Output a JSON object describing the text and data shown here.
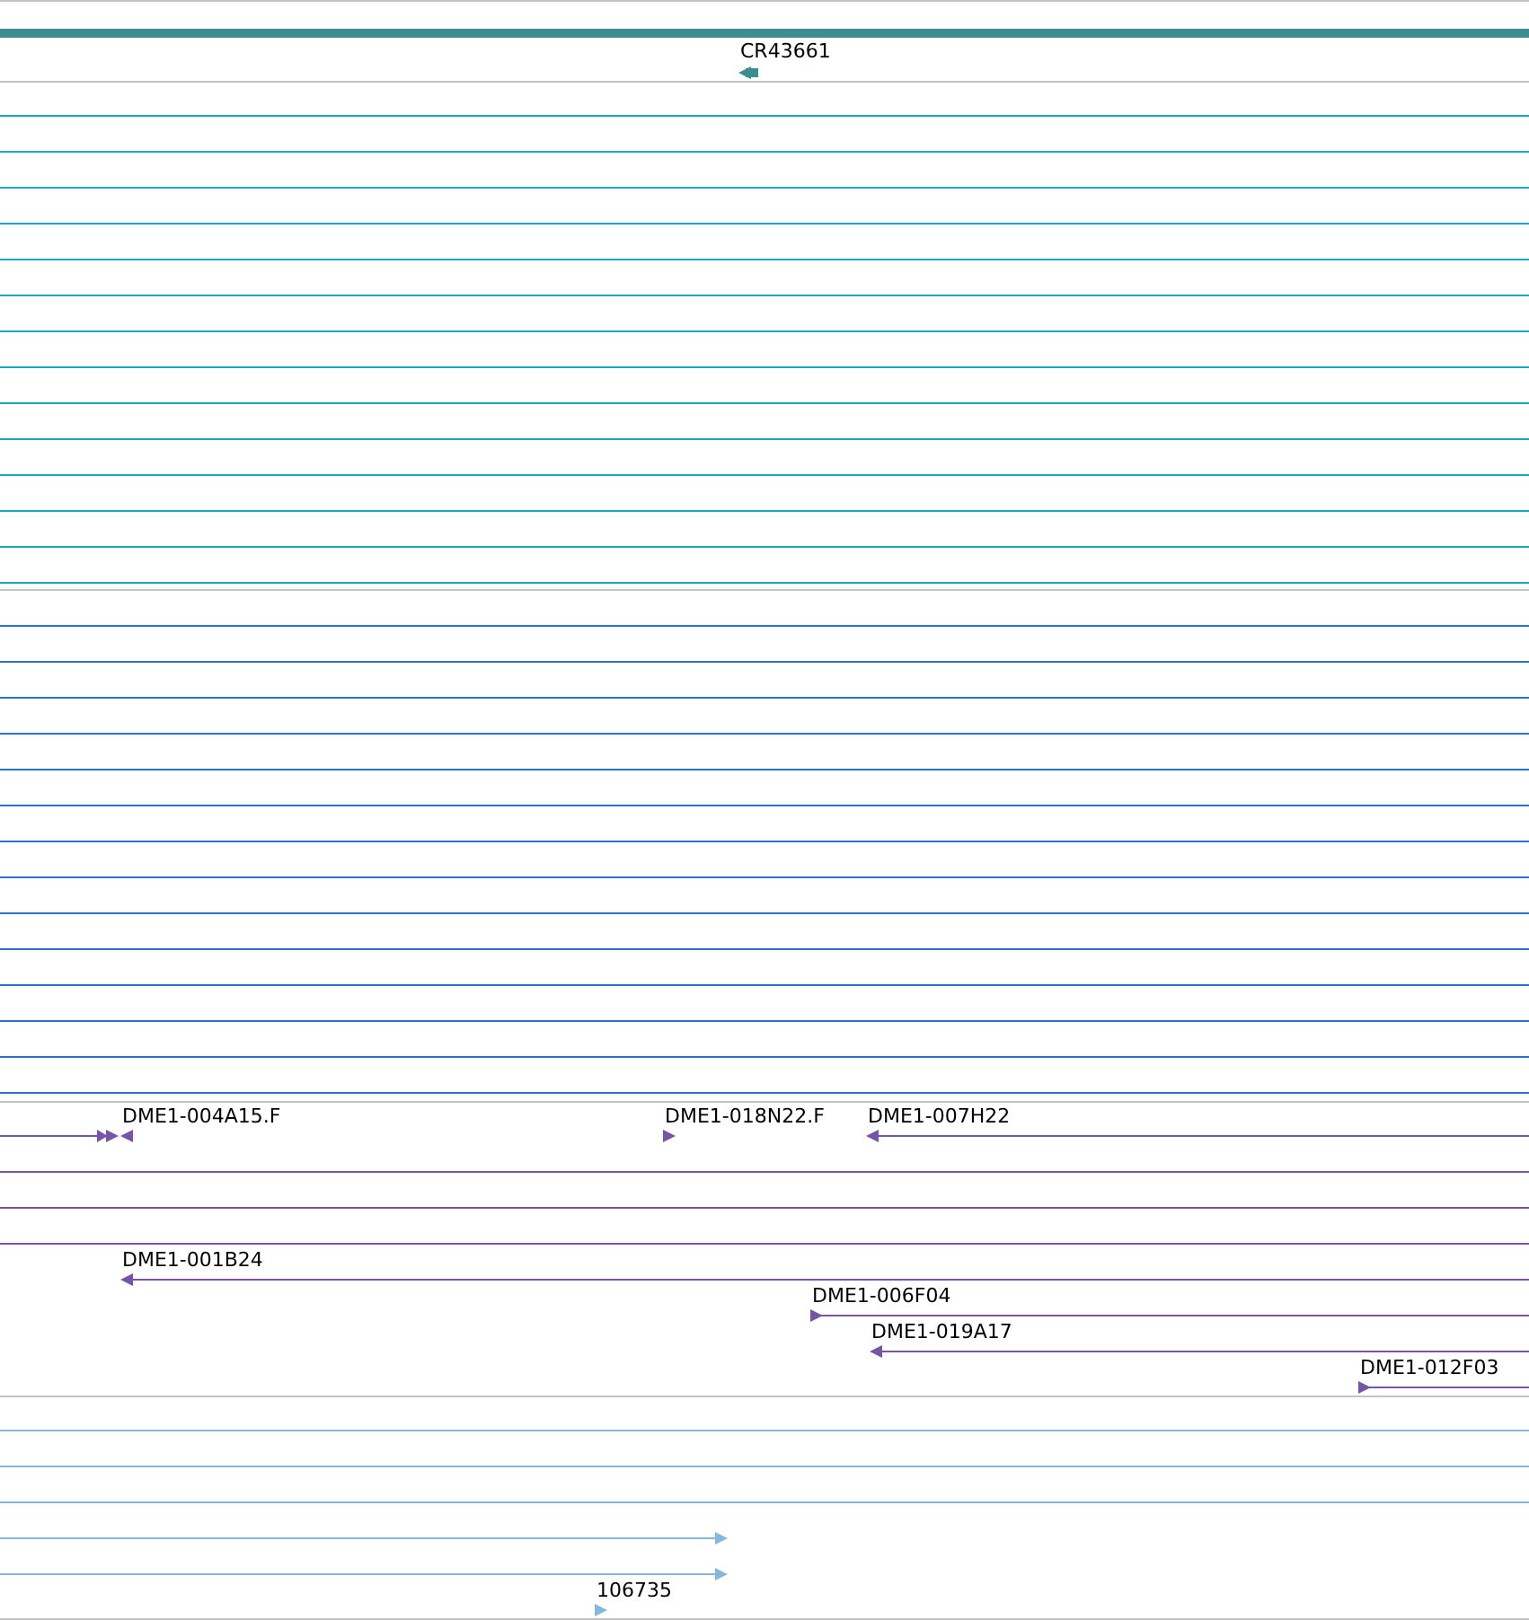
{
  "tracks": [
    {
      "kind": "bar",
      "color": "#3a8e91",
      "features": [
        {
          "label": "CR43661",
          "reverse": true
        }
      ]
    },
    {
      "kind": "lines",
      "color": "#1ba6c6"
    },
    {
      "kind": "lines",
      "color": "#2a6fd3"
    },
    {
      "kind": "features",
      "color": "#7555a8",
      "features": [
        {
          "label": "DME1-004A15.F",
          "reverse": true
        },
        {
          "label": "DME1-018N22.F",
          "reverse": false
        },
        {
          "label": "DME1-007H22",
          "reverse": true
        },
        {
          "label": "DME1-001B24",
          "reverse": true
        },
        {
          "label": "DME1-006F04",
          "reverse": false
        },
        {
          "label": "DME1-019A17",
          "reverse": true
        },
        {
          "label": "DME1-012F03",
          "reverse": false
        }
      ]
    },
    {
      "kind": "features",
      "color": "#86b8dc",
      "features": [
        {
          "label": "106735",
          "reverse": false
        }
      ]
    }
  ]
}
